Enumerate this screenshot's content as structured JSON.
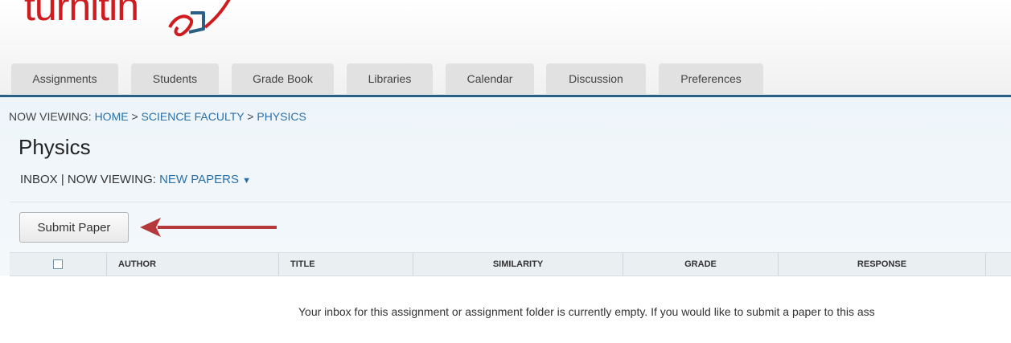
{
  "logo": {
    "text": "turnitin"
  },
  "tabs": [
    {
      "label": "Assignments"
    },
    {
      "label": "Students"
    },
    {
      "label": "Grade Book"
    },
    {
      "label": "Libraries"
    },
    {
      "label": "Calendar"
    },
    {
      "label": "Discussion"
    },
    {
      "label": "Preferences"
    }
  ],
  "breadcrumb": {
    "prefix": "NOW VIEWING: ",
    "home": "HOME",
    "sep1": " > ",
    "faculty": "SCIENCE FACULTY",
    "sep2": " > ",
    "current": "PHYSICS"
  },
  "page": {
    "title": "Physics",
    "inbox_label": "INBOX",
    "viewing_prefix": " | NOW VIEWING: ",
    "viewing_value": "NEW PAPERS",
    "dropdown_glyph": "▼"
  },
  "actions": {
    "submit_label": "Submit Paper"
  },
  "table": {
    "columns": [
      "AUTHOR",
      "TITLE",
      "SIMILARITY",
      "GRADE",
      "RESPONSE"
    ]
  },
  "empty_message": "Your inbox for this assignment or assignment folder is currently empty. If you would like to submit a paper to this ass",
  "colors": {
    "brand": "#d01b1f",
    "link": "#2a6fa8",
    "tab_underline": "#2a5f86",
    "annotation_arrow": "#b5393a"
  }
}
